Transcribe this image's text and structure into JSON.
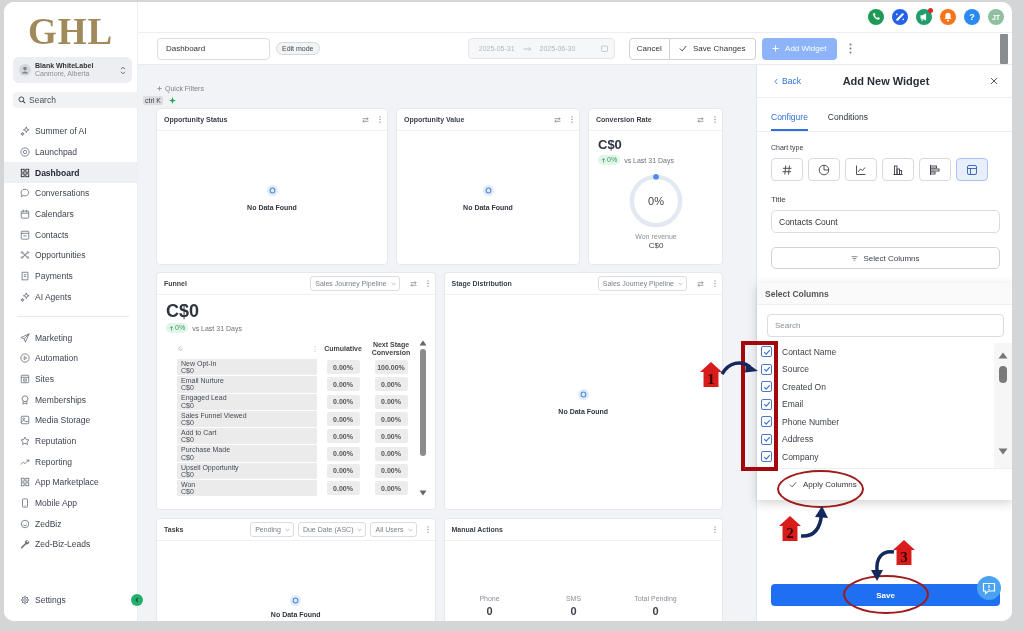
{
  "sidebar": {
    "logo": "GHL",
    "account": {
      "name": "Blank WhiteLabel",
      "location": "Canmore, Alberta"
    },
    "search": {
      "placeholder": "Search",
      "shortcut": "ctrl K"
    },
    "groups": [
      {
        "items": [
          {
            "label": "Summer of AI",
            "selected": false
          },
          {
            "label": "Launchpad",
            "selected": false
          },
          {
            "label": "Dashboard",
            "selected": true
          },
          {
            "label": "Conversations",
            "selected": false
          },
          {
            "label": "Calendars",
            "selected": false
          },
          {
            "label": "Contacts",
            "selected": false
          },
          {
            "label": "Opportunities",
            "selected": false
          },
          {
            "label": "Payments",
            "selected": false
          },
          {
            "label": "AI Agents",
            "selected": false
          }
        ]
      },
      {
        "items": [
          {
            "label": "Marketing",
            "selected": false
          },
          {
            "label": "Automation",
            "selected": false
          },
          {
            "label": "Sites",
            "selected": false
          },
          {
            "label": "Memberships",
            "selected": false
          },
          {
            "label": "Media Storage",
            "selected": false
          },
          {
            "label": "Reputation",
            "selected": false
          },
          {
            "label": "Reporting",
            "selected": false
          },
          {
            "label": "App Marketplace",
            "selected": false
          },
          {
            "label": "Mobile App",
            "selected": false
          },
          {
            "label": "ZedBiz",
            "selected": false
          },
          {
            "label": "Zed-Biz-Leads",
            "selected": false
          }
        ]
      }
    ],
    "settings": "Settings"
  },
  "top_bar": {
    "unread_announcements": true,
    "help": "?",
    "avatar": "JT"
  },
  "toolbar": {
    "dashboard_name": "Dashboard",
    "mode": "Edit mode",
    "date_range": {
      "start": "2025-05-31",
      "end": "2025-06-30",
      "disabled": true
    },
    "cancel": "Cancel",
    "save_changes": "Save Changes",
    "add_widget": {
      "label": "Add Widget",
      "disabled": true
    }
  },
  "dashboard": {
    "quick_filters": "Quick Filters",
    "widget_rows": [
      {
        "widgets": [
          {
            "kind": "empty",
            "title": "Opportunity Status",
            "message": "No Data Found"
          },
          {
            "kind": "empty",
            "title": "Opportunity Value",
            "message": "No Data Found"
          },
          {
            "kind": "metric",
            "title": "Conversion Rate",
            "value": "C$0",
            "change": "0%",
            "comparison": "vs Last 31 Days",
            "gauge": {
              "reading": "0%"
            },
            "caption": "Won revenue",
            "caption_value": "C$0"
          }
        ]
      },
      {
        "widgets": [
          {
            "kind": "funnel",
            "title": "Funnel",
            "filters": [
              "Sales Journey Pipeline"
            ],
            "value": "C$0",
            "change": "0%",
            "comparison": "vs Last 31 Days",
            "columns": [
              "Cumulative",
              "Next Stage Conversion"
            ],
            "stages": [
              {
                "name": "New Opt-In",
                "amount": "C$0",
                "cumulative": "0.00%",
                "next": "100.00%"
              },
              {
                "name": "Email Nurture",
                "amount": "C$0",
                "cumulative": "0.00%",
                "next": "0.00%"
              },
              {
                "name": "Engaged Lead",
                "amount": "C$0",
                "cumulative": "0.00%",
                "next": "0.00%"
              },
              {
                "name": "Sales Funnel Viewed",
                "amount": "C$0",
                "cumulative": "0.00%",
                "next": "0.00%"
              },
              {
                "name": "Add to Cart",
                "amount": "C$0",
                "cumulative": "0.00%",
                "next": "0.00%"
              },
              {
                "name": "Purchase Made",
                "amount": "C$0",
                "cumulative": "0.00%",
                "next": "0.00%"
              },
              {
                "name": "Upsell Opportunity",
                "amount": "C$0",
                "cumulative": "0.00%",
                "next": "0.00%"
              },
              {
                "name": "Won",
                "amount": "C$0",
                "cumulative": "0.00%",
                "next": "0.00%"
              }
            ]
          },
          {
            "kind": "empty",
            "title": "Stage Distribution",
            "filters": [
              "Sales Journey Pipeline"
            ],
            "message": "No Data Found"
          }
        ]
      },
      {
        "widgets": [
          {
            "kind": "tasks",
            "title": "Tasks",
            "filters": [
              "Pending",
              "Due Date (ASC)",
              "All Users"
            ],
            "message": "No Data Found"
          },
          {
            "kind": "manual_actions",
            "title": "Manual Actions",
            "stats": [
              {
                "label": "Phone",
                "value": "0"
              },
              {
                "label": "SMS",
                "value": "0"
              },
              {
                "label": "Total Pending",
                "value": "0"
              }
            ]
          }
        ]
      }
    ]
  },
  "widget_panel": {
    "back": "Back",
    "title": "Add New Widget",
    "tabs": [
      {
        "label": "Configure",
        "selected": true
      },
      {
        "label": "Conditions",
        "selected": false
      }
    ],
    "chart_type_label": "Chart type",
    "chart_types": [
      {
        "kind": "number",
        "selected": false
      },
      {
        "kind": "pie",
        "selected": false
      },
      {
        "kind": "line",
        "selected": false
      },
      {
        "kind": "bar",
        "selected": false
      },
      {
        "kind": "horizontal_bar",
        "selected": false
      },
      {
        "kind": "table",
        "selected": true
      }
    ],
    "title_label": "Title",
    "title_value": "Contacts Count",
    "select_columns": "Select Columns",
    "save": "Save"
  },
  "column_picker": {
    "title": "Select Columns",
    "search_placeholder": "Search",
    "columns": [
      {
        "label": "Contact Name",
        "checked": true
      },
      {
        "label": "Source",
        "checked": true
      },
      {
        "label": "Created On",
        "checked": true
      },
      {
        "label": "Email",
        "checked": true
      },
      {
        "label": "Phone Number",
        "checked": true
      },
      {
        "label": "Address",
        "checked": true
      },
      {
        "label": "Company",
        "checked": true
      }
    ],
    "apply": "Apply Columns"
  },
  "annotations": [
    {
      "number": "1"
    },
    {
      "number": "2"
    },
    {
      "number": "3"
    }
  ]
}
